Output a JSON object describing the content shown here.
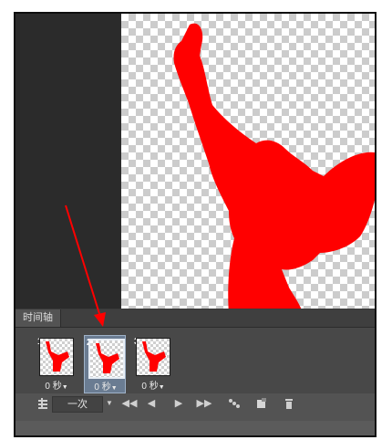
{
  "timeline": {
    "tab_label": "时间轴",
    "frames": [
      {
        "number": "1",
        "delay": "0 秒",
        "selected": false
      },
      {
        "number": "2",
        "delay": "0 秒",
        "selected": true
      },
      {
        "number": "3",
        "delay": "0 秒",
        "selected": false
      }
    ],
    "loop_label": "一次",
    "toolbar_icons": [
      "convert-timeline-icon",
      "loop-dropdown-icon",
      "first-frame-icon",
      "previous-frame-icon",
      "play-icon",
      "next-frame-icon",
      "tween-icon",
      "duplicate-frame-icon",
      "delete-frame-icon"
    ]
  },
  "colors": {
    "figure": "#ff0000",
    "annotation_arrow": "#ff0000",
    "panel": "#535353",
    "selected_frame": "#6a7c92"
  }
}
